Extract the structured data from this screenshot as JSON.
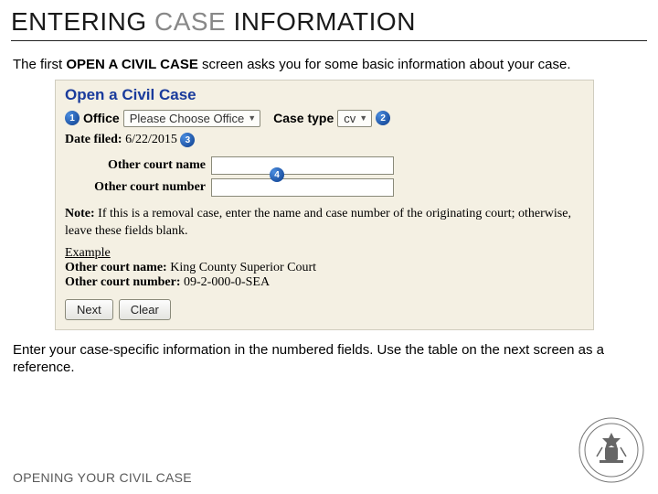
{
  "title": {
    "part1": "ENTERING ",
    "part2": "CASE ",
    "part3": "INFORMATION"
  },
  "intro": {
    "pre": "The first ",
    "bold": "OPEN A CIVIL CASE",
    "post": " screen asks you for some basic information about your case."
  },
  "screenshot": {
    "heading": "Open a Civil Case",
    "badge1": "1",
    "office_label": "Office",
    "office_dropdown": "Please Choose Office",
    "casetype_label": "Case type",
    "casetype_dropdown": "cv",
    "badge2": "2",
    "datefiled_label": "Date filed:",
    "datefiled_value": "6/22/2015",
    "badge3": "3",
    "other_court_name_label": "Other court name",
    "other_court_number_label": "Other court number",
    "badge4": "4",
    "note_label": "Note:",
    "note_text": " If this is a removal case, enter the name and case number of the originating court; otherwise, leave these fields blank.",
    "example_label": "Example",
    "example_name_label": "Other court name:",
    "example_name_value": " King County Superior Court",
    "example_number_label": "Other court number:",
    "example_number_value": " 09-2-000-0-SEA",
    "next_btn": "Next",
    "clear_btn": "Clear"
  },
  "outro": "Enter your case-specific information in the numbered fields. Use the table on the next screen as a reference.",
  "footer": "OPENING YOUR CIVIL CASE"
}
